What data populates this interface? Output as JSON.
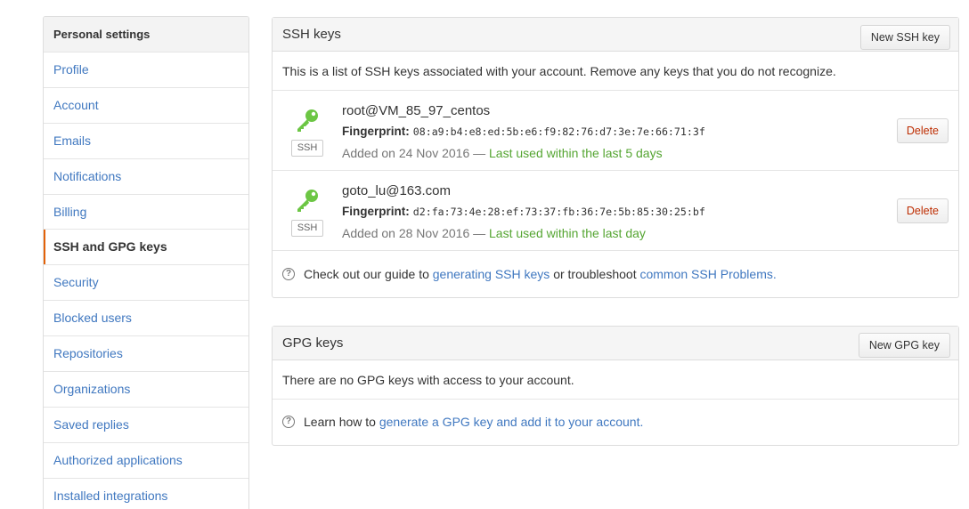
{
  "sidebar": {
    "header": "Personal settings",
    "items": [
      {
        "label": "Profile"
      },
      {
        "label": "Account"
      },
      {
        "label": "Emails"
      },
      {
        "label": "Notifications"
      },
      {
        "label": "Billing"
      },
      {
        "label": "SSH and GPG keys",
        "selected": true
      },
      {
        "label": "Security"
      },
      {
        "label": "Blocked users"
      },
      {
        "label": "Repositories"
      },
      {
        "label": "Organizations"
      },
      {
        "label": "Saved replies"
      },
      {
        "label": "Authorized applications"
      },
      {
        "label": "Installed integrations"
      }
    ]
  },
  "ssh": {
    "title": "SSH keys",
    "new_button": "New SSH key",
    "intro": "This is a list of SSH keys associated with your account. Remove any keys that you do not recognize.",
    "keys": [
      {
        "title": "root@VM_85_97_centos",
        "type_label": "SSH",
        "fingerprint_label": "Fingerprint:",
        "fingerprint": "08:a9:b4:e8:ed:5b:e6:f9:82:76:d7:3e:7e:66:71:3f",
        "added": "Added on 24 Nov 2016 —",
        "last_used": "Last used within the last 5 days",
        "delete_label": "Delete"
      },
      {
        "title": "goto_lu@163.com",
        "type_label": "SSH",
        "fingerprint_label": "Fingerprint:",
        "fingerprint": "d2:fa:73:4e:28:ef:73:37:fb:36:7e:5b:85:30:25:bf",
        "added": "Added on 28 Nov 2016 —",
        "last_used": "Last used within the last day",
        "delete_label": "Delete"
      }
    ],
    "help_prefix": "Check out our guide to",
    "help_link1": "generating SSH keys",
    "help_middle": "or troubleshoot",
    "help_link2": "common SSH Problems",
    "help_suffix": "."
  },
  "gpg": {
    "title": "GPG keys",
    "new_button": "New GPG key",
    "empty": "There are no GPG keys with access to your account.",
    "help_prefix": "Learn how to",
    "help_link": "generate a GPG key and add it to your account",
    "help_suffix": "."
  },
  "colors": {
    "link": "#4078c0",
    "key_icon": "#6cc644",
    "last_used": "#55a532",
    "delete_text": "#bd2c00",
    "selected_marker": "#e36209"
  },
  "icons": {
    "key": "key-icon",
    "help": "question-icon"
  }
}
